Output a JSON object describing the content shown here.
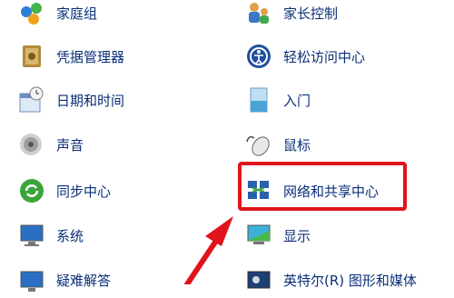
{
  "items": [
    {
      "id": "homegroup",
      "label": "家庭组",
      "icon": "homegroup-icon"
    },
    {
      "id": "parental-controls",
      "label": "家长控制",
      "icon": "parental-controls-icon"
    },
    {
      "id": "credential-manager",
      "label": "凭据管理器",
      "icon": "vault-icon"
    },
    {
      "id": "ease-of-access",
      "label": "轻松访问中心",
      "icon": "ease-of-access-icon"
    },
    {
      "id": "date-time",
      "label": "日期和时间",
      "icon": "calendar-clock-icon"
    },
    {
      "id": "getting-started",
      "label": "入门",
      "icon": "getting-started-icon"
    },
    {
      "id": "sound",
      "label": "声音",
      "icon": "speaker-icon"
    },
    {
      "id": "mouse",
      "label": "鼠标",
      "icon": "mouse-icon"
    },
    {
      "id": "sync-center",
      "label": "同步中心",
      "icon": "sync-icon"
    },
    {
      "id": "network-sharing",
      "label": "网络和共享中心",
      "icon": "network-icon"
    },
    {
      "id": "system",
      "label": "系统",
      "icon": "system-monitor-icon"
    },
    {
      "id": "display",
      "label": "显示",
      "icon": "display-icon"
    },
    {
      "id": "troubleshooting",
      "label": "疑难解答",
      "icon": "troubleshooting-icon"
    },
    {
      "id": "intel-graphics",
      "label": "英特尔(R) 图形和媒体",
      "icon": "intel-graphics-icon"
    }
  ],
  "annotation": {
    "highlight_color": "#e0141c",
    "arrow_color": "#e0141c"
  }
}
